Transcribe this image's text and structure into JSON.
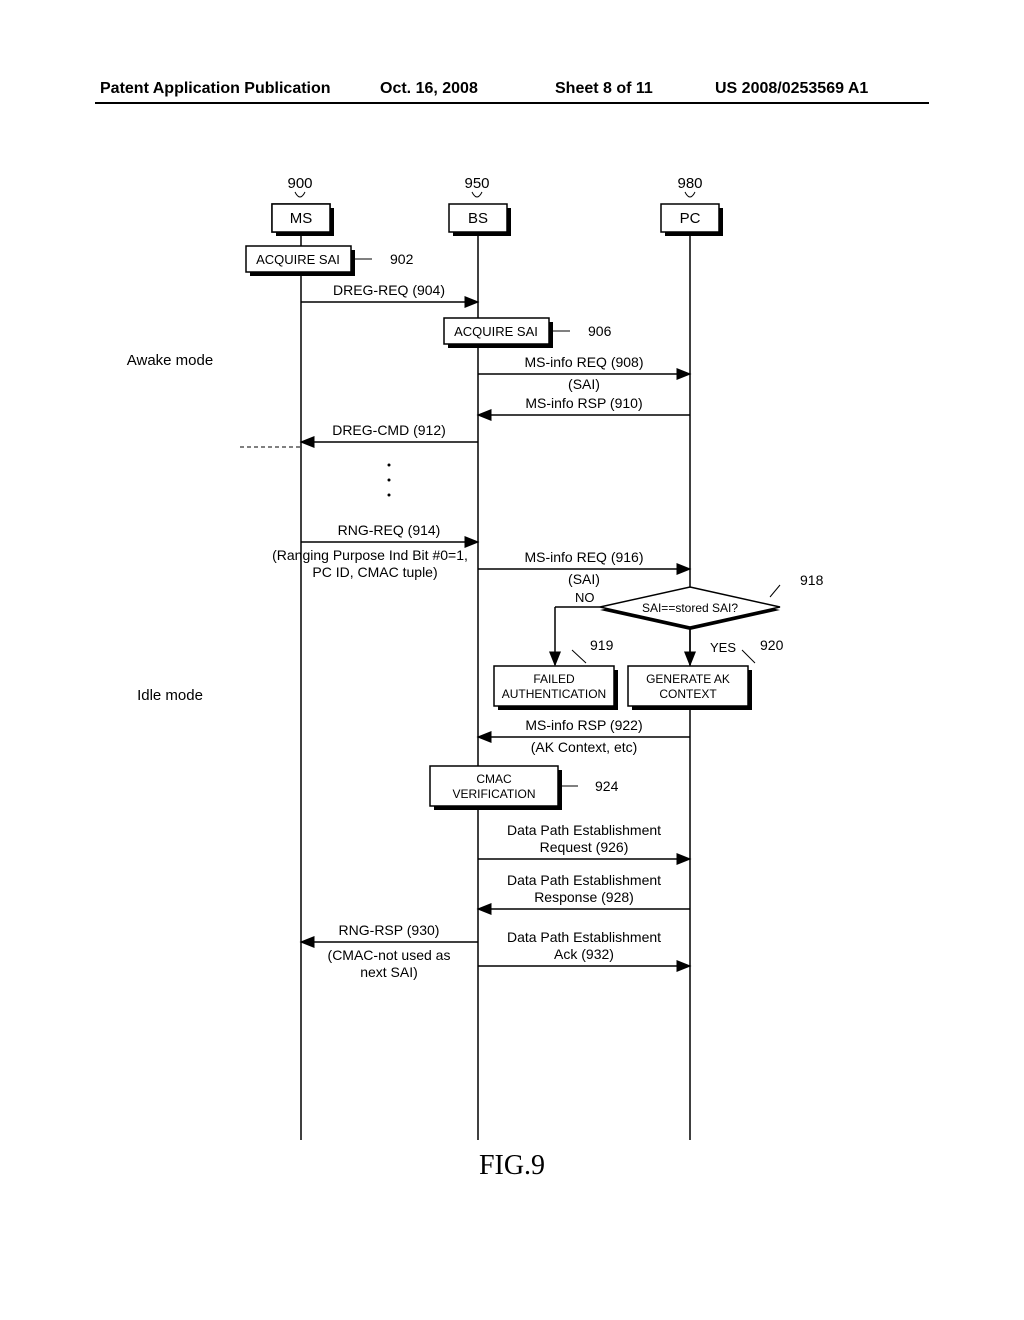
{
  "header": {
    "left": "Patent Application Publication",
    "date": "Oct. 16, 2008",
    "sheet": "Sheet 8 of 11",
    "pubno": "US 2008/0253569 A1"
  },
  "actors": {
    "ms": {
      "num": "900",
      "label": "MS"
    },
    "bs": {
      "num": "950",
      "label": "BS"
    },
    "pc": {
      "num": "980",
      "label": "PC"
    }
  },
  "modes": {
    "awake": "Awake mode",
    "idle": "Idle mode"
  },
  "steps": {
    "s902": {
      "label": "ACQUIRE SAI",
      "num": "902"
    },
    "s904": "DREG-REQ (904)",
    "s906": {
      "label": "ACQUIRE SAI",
      "num": "906"
    },
    "s908a": "MS-info REQ (908)",
    "s908b": "(SAI)",
    "s910": "MS-info RSP (910)",
    "s912": "DREG-CMD (912)",
    "s914": "RNG-REQ (914)",
    "s914b1": "(Ranging Purpose Ind Bit #0=1,",
    "s914b2": "PC ID, CMAC tuple)",
    "s916a": "MS-info REQ (916)",
    "s916b": "(SAI)",
    "decision": {
      "no": "NO",
      "yes": "YES",
      "text": "SAI==stored SAI?",
      "ref918": "918"
    },
    "s919": {
      "label1": "FAILED",
      "label2": "AUTHENTICATION",
      "num": "919"
    },
    "s920": {
      "label1": "GENERATE AK",
      "label2": "CONTEXT",
      "num": "920"
    },
    "s922a": "MS-info RSP (922)",
    "s922b": "(AK Context, etc)",
    "s924": {
      "label1": "CMAC",
      "label2": "VERIFICATION",
      "num": "924"
    },
    "s926a": "Data Path Establishment",
    "s926b": "Request (926)",
    "s928a": "Data Path Establishment",
    "s928b": "Response (928)",
    "s930a": "RNG-RSP (930)",
    "s930b1": "(CMAC-not used as",
    "s930b2": "next SAI)",
    "s932a": "Data Path Establishment",
    "s932b": "Ack (932)"
  },
  "figcaption": "FIG.9"
}
